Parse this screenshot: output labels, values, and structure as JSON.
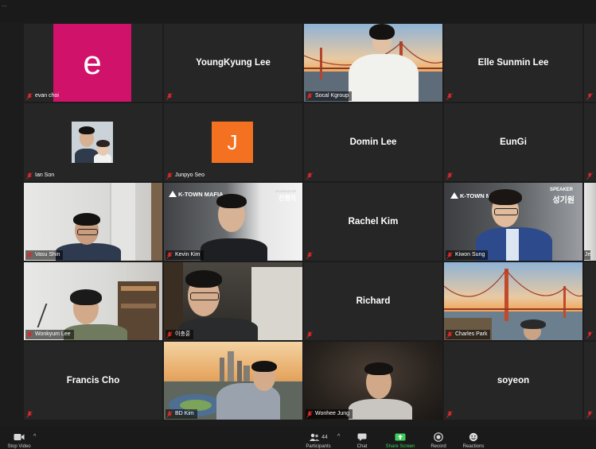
{
  "window": {
    "title_fragment": "..."
  },
  "tiles": [
    {
      "name": "evan choi",
      "avatar_letter": "e",
      "avatar_color": "#d0126a"
    },
    {
      "name": "YoungKyung Lee"
    },
    {
      "name": "Socal Kgroup"
    },
    {
      "name": "Elle Sunmin Lee"
    },
    {
      "name": "Ian Son"
    },
    {
      "name": "Junpyo Seo",
      "avatar_letter": "J",
      "avatar_color": "#f37121"
    },
    {
      "name": "Domin Lee"
    },
    {
      "name": "EunGi"
    },
    {
      "name": "Vasu Shin"
    },
    {
      "name": "Kevin Kim",
      "logo": "K-TOWN MAFIA",
      "role_en": "MODERATOR",
      "role_ko": "진행자"
    },
    {
      "name": "Rachel Kim"
    },
    {
      "name": "Kiwon Sung",
      "logo": "K-TOWN MAFIA",
      "role_en": "SPEAKER",
      "role_ko": "성기원"
    },
    {
      "name": "Wonkyum Lee"
    },
    {
      "name": "이충훈"
    },
    {
      "name": "Richard"
    },
    {
      "name": "Charles Park"
    },
    {
      "name": "Francis Cho"
    },
    {
      "name": "BD Kim"
    },
    {
      "name": "Wonhee Jung"
    },
    {
      "name": "soyeon"
    },
    {
      "name": "Je"
    }
  ],
  "toolbar": {
    "stop_video": "Stop Video",
    "participants": "Participants",
    "participants_count": "44",
    "chat": "Chat",
    "share_screen": "Share Screen",
    "record": "Record",
    "reactions": "Reactions"
  },
  "colors": {
    "active_speaker": "#b9d86b",
    "mute": "#e02828",
    "share_green": "#3ecf5d"
  }
}
